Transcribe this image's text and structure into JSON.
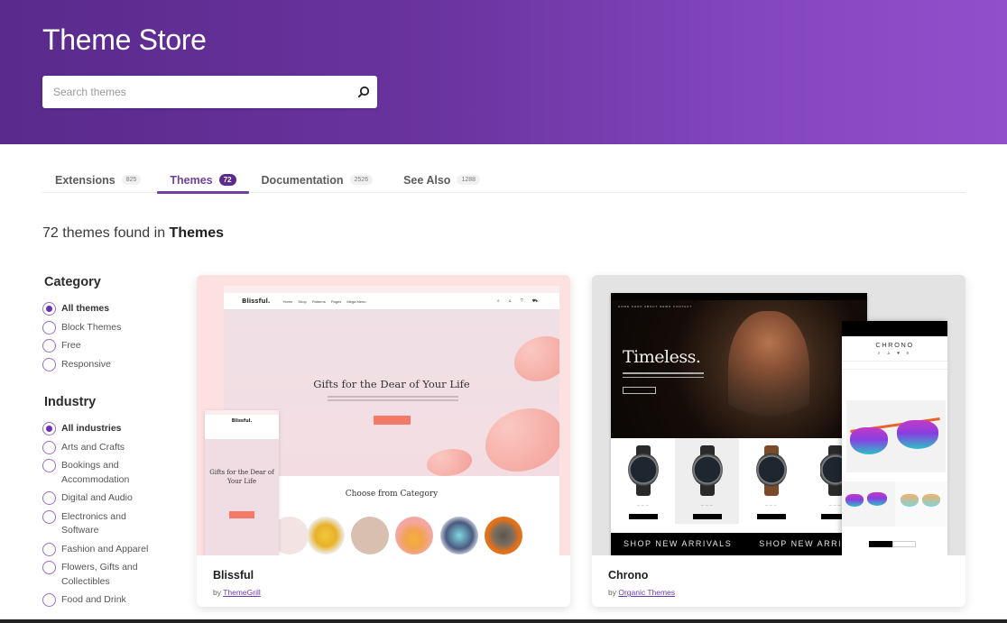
{
  "header": {
    "title": "Theme Store",
    "search": {
      "placeholder": "Search themes",
      "value": "",
      "icon": "search-icon"
    }
  },
  "tabs": [
    {
      "label": "Extensions",
      "count": "825",
      "active": false
    },
    {
      "label": "Themes",
      "count": "72",
      "active": true
    },
    {
      "label": "Documentation",
      "count": "2526",
      "active": false
    },
    {
      "label": "See Also",
      "count": "1288",
      "active": false
    }
  ],
  "results": {
    "count_text": "72 themes found in",
    "scope": "Themes"
  },
  "filters": {
    "category": {
      "title": "Category",
      "options": [
        {
          "label": "All themes",
          "checked": true
        },
        {
          "label": "Block Themes",
          "checked": false
        },
        {
          "label": "Free",
          "checked": false
        },
        {
          "label": "Responsive",
          "checked": false
        }
      ]
    },
    "industry": {
      "title": "Industry",
      "options": [
        {
          "label": "All industries",
          "checked": true
        },
        {
          "label": "Arts and Crafts",
          "checked": false
        },
        {
          "label": "Bookings and Accommodation",
          "checked": false
        },
        {
          "label": "Digital and Audio",
          "checked": false
        },
        {
          "label": "Electronics and Software",
          "checked": false
        },
        {
          "label": "Fashion and Apparel",
          "checked": false
        },
        {
          "label": "Flowers, Gifts and Collectibles",
          "checked": false
        },
        {
          "label": "Food and Drink",
          "checked": false
        }
      ]
    }
  },
  "themes": [
    {
      "name": "Blissful",
      "by": "by",
      "author": "ThemeGrill",
      "preview": {
        "logo": "Blissful.",
        "nav": [
          "Home",
          "Shop",
          "Patterns",
          "Pages",
          "Mega Menu"
        ],
        "heading": "Gifts for the Dear of Your Life",
        "section_title": "Choose from Category",
        "mobile_heading": "Gifts for the Dear of Your Life",
        "mobile_logo": "Blissful."
      }
    },
    {
      "name": "Chrono",
      "by": "by",
      "author": "Organic Themes",
      "preview": {
        "nav": "HOME  SHOP  ABOUT  NEWS  CONTACT",
        "heading": "Timeless.",
        "banner": [
          "SHOP NEW ARRIVALS",
          "SHOP NEW ARRIVALS"
        ],
        "mobile_logo": "CHRONO",
        "mobile_icons": "⌕ ♙ ♥ ≡"
      }
    }
  ],
  "colors": {
    "brand_purple": "#7040a6",
    "hero_gradient_start": "#5a2a8c",
    "hero_gradient_end": "#9150cb",
    "link": "#6a3aa8"
  }
}
